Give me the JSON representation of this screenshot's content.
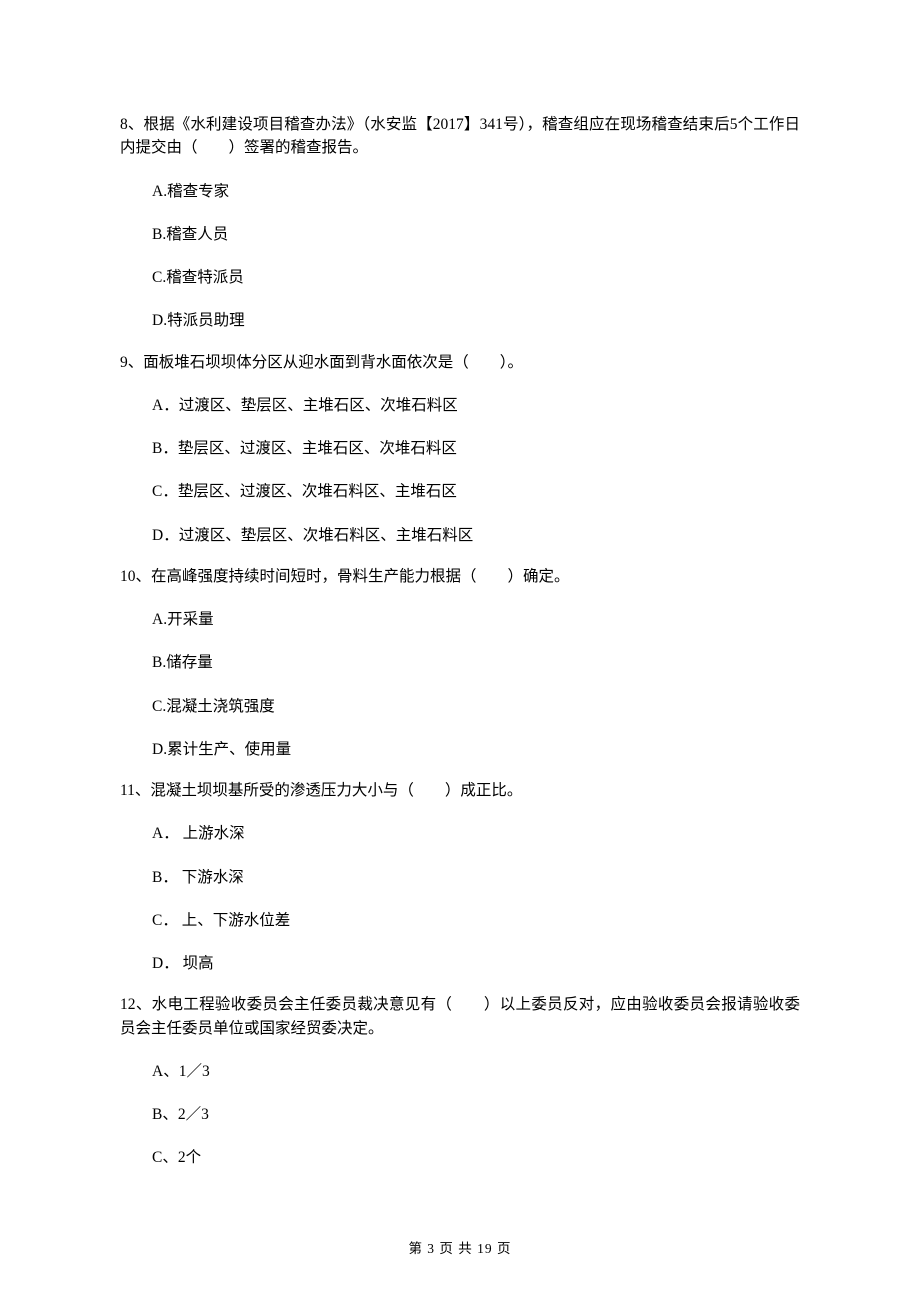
{
  "questions": [
    {
      "number": "8",
      "stem": "8、根据《水利建设项目稽查办法》（水安监【2017】341号），稽查组应在现场稽查结束后5个工作日内提交由（　　）签署的稽查报告。",
      "options": [
        "A.稽查专家",
        "B.稽查人员",
        "C.稽查特派员",
        "D.特派员助理"
      ]
    },
    {
      "number": "9",
      "stem": "9、面板堆石坝坝体分区从迎水面到背水面依次是（　　）。",
      "options": [
        "A．过渡区、垫层区、主堆石区、次堆石料区",
        "B．垫层区、过渡区、主堆石区、次堆石料区",
        "C．垫层区、过渡区、次堆石料区、主堆石区",
        "D．过渡区、垫层区、次堆石料区、主堆石料区"
      ]
    },
    {
      "number": "10",
      "stem": "10、在高峰强度持续时间短时，骨料生产能力根据（　　）确定。",
      "options": [
        "A.开采量",
        "B.储存量",
        "C.混凝土浇筑强度",
        "D.累计生产、使用量"
      ]
    },
    {
      "number": "11",
      "stem": "11、混凝土坝坝基所受的渗透压力大小与（　　）成正比。",
      "options": [
        "A． 上游水深",
        "B． 下游水深",
        "C． 上、下游水位差",
        "D． 坝高"
      ]
    },
    {
      "number": "12",
      "stem": "12、水电工程验收委员会主任委员裁决意见有（　　）以上委员反对，应由验收委员会报请验收委员会主任委员单位或国家经贸委决定。",
      "options": [
        "A、1／3",
        "B、2／3",
        "C、2个"
      ]
    }
  ],
  "footer": "第 3 页 共 19 页"
}
